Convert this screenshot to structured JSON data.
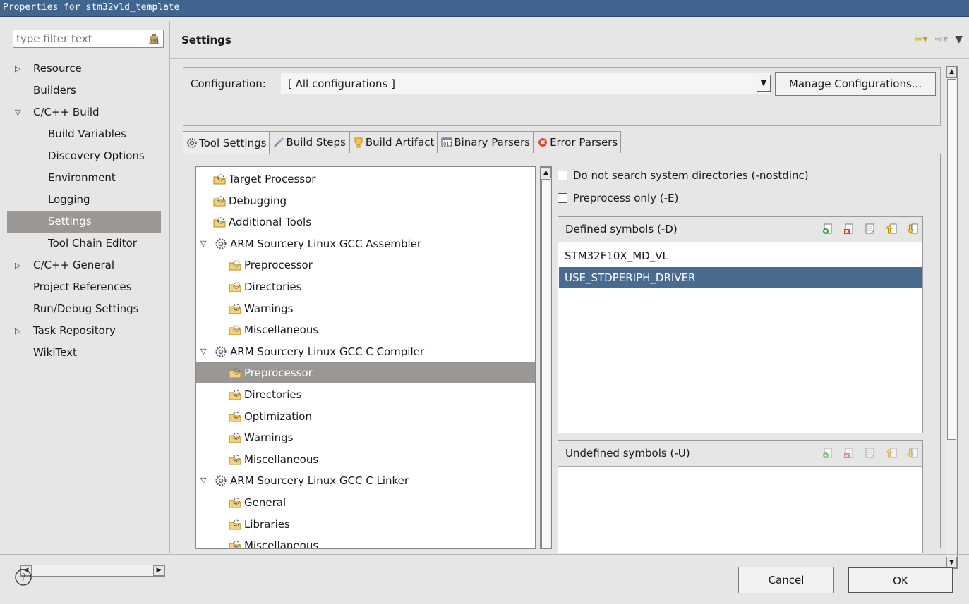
{
  "window": {
    "title": "Properties for stm32vld_template"
  },
  "sidebar": {
    "filter_placeholder": "type filter text",
    "items": [
      {
        "label": "Resource",
        "arrow": "▷",
        "level": 0
      },
      {
        "label": "Builders",
        "arrow": "",
        "level": 0
      },
      {
        "label": "C/C++ Build",
        "arrow": "▽",
        "level": 0
      },
      {
        "label": "Build Variables",
        "arrow": "",
        "level": 1
      },
      {
        "label": "Discovery Options",
        "arrow": "",
        "level": 1
      },
      {
        "label": "Environment",
        "arrow": "",
        "level": 1
      },
      {
        "label": "Logging",
        "arrow": "",
        "level": 1
      },
      {
        "label": "Settings",
        "arrow": "",
        "level": 1,
        "selected": true
      },
      {
        "label": "Tool Chain Editor",
        "arrow": "",
        "level": 1
      },
      {
        "label": "C/C++ General",
        "arrow": "▷",
        "level": 0
      },
      {
        "label": "Project References",
        "arrow": "",
        "level": 0
      },
      {
        "label": "Run/Debug Settings",
        "arrow": "",
        "level": 0
      },
      {
        "label": "Task Repository",
        "arrow": "▷",
        "level": 0
      },
      {
        "label": "WikiText",
        "arrow": "",
        "level": 0
      }
    ]
  },
  "main": {
    "title": "Settings",
    "configuration_label": "Configuration:",
    "configuration_value": "[ All configurations ]",
    "manage_button": "Manage Configurations...",
    "tabs": [
      {
        "label": "Tool Settings",
        "icon": "gear-icon",
        "active": true
      },
      {
        "label": "Build Steps",
        "icon": "steps-icon"
      },
      {
        "label": "Build Artifact",
        "icon": "artifact-icon"
      },
      {
        "label": "Binary Parsers",
        "icon": "binary-icon"
      },
      {
        "label": "Error Parsers",
        "icon": "error-icon"
      }
    ],
    "tool_tree": [
      {
        "label": "Target Processor",
        "level": 0,
        "type": "leaf"
      },
      {
        "label": "Debugging",
        "level": 0,
        "type": "leaf"
      },
      {
        "label": "Additional Tools",
        "level": 0,
        "type": "leaf"
      },
      {
        "label": "ARM Sourcery Linux GCC Assembler",
        "level": 0,
        "type": "tool"
      },
      {
        "label": "Preprocessor",
        "level": 1,
        "type": "leaf"
      },
      {
        "label": "Directories",
        "level": 1,
        "type": "leaf"
      },
      {
        "label": "Warnings",
        "level": 1,
        "type": "leaf"
      },
      {
        "label": "Miscellaneous",
        "level": 1,
        "type": "leaf"
      },
      {
        "label": "ARM Sourcery Linux GCC C Compiler",
        "level": 0,
        "type": "tool"
      },
      {
        "label": "Preprocessor",
        "level": 1,
        "type": "leaf",
        "selected": true
      },
      {
        "label": "Directories",
        "level": 1,
        "type": "leaf"
      },
      {
        "label": "Optimization",
        "level": 1,
        "type": "leaf"
      },
      {
        "label": "Warnings",
        "level": 1,
        "type": "leaf"
      },
      {
        "label": "Miscellaneous",
        "level": 1,
        "type": "leaf"
      },
      {
        "label": "ARM Sourcery Linux GCC C Linker",
        "level": 0,
        "type": "tool"
      },
      {
        "label": "General",
        "level": 1,
        "type": "leaf"
      },
      {
        "label": "Libraries",
        "level": 1,
        "type": "leaf"
      },
      {
        "label": "Miscellaneous",
        "level": 1,
        "type": "leaf"
      }
    ],
    "options": {
      "nostdinc_label": "Do not search system directories (-nostdinc)",
      "preprocess_only_label": "Preprocess only (-E)",
      "defined_symbols_title": "Defined symbols (-D)",
      "defined_symbols": [
        "STM32F10X_MD_VL",
        "USE_STDPERIPH_DRIVER"
      ],
      "undefined_symbols_title": "Undefined symbols (-U)",
      "undefined_symbols": []
    }
  },
  "footer": {
    "cancel": "Cancel",
    "ok": "OK"
  }
}
